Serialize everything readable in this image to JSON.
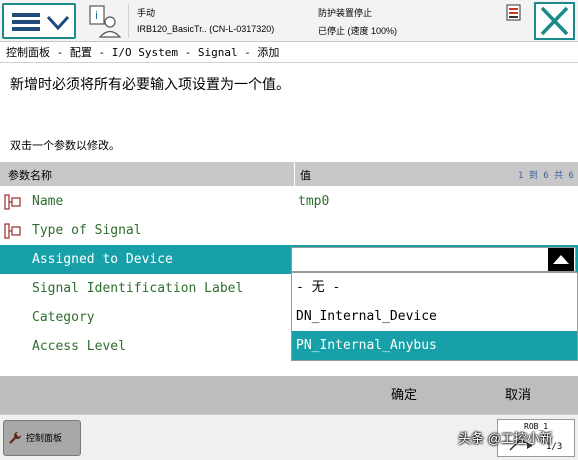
{
  "status": {
    "mode": "手动",
    "controller": "IRB120_BasicTr.. (CN-L-0317320)",
    "safety": "防护装置停止",
    "state": "已停止 (速度 100%)"
  },
  "breadcrumb": "控制面板 - 配置 - I/O System - Signal - 添加",
  "instruction": "新增时必须将所有必要输入项设置为一个值。",
  "hint": "双击一个参数以修改。",
  "table": {
    "col_name": "参数名称",
    "col_value": "值",
    "paging": "1 到 6 共 6",
    "rows": [
      {
        "label": "Name",
        "value": "tmp0",
        "required": true
      },
      {
        "label": "Type of Signal",
        "value": "",
        "required": true
      },
      {
        "label": "Assigned to Device",
        "value": "",
        "required": false
      },
      {
        "label": "Signal Identification Label",
        "value": "",
        "required": false
      },
      {
        "label": "Category",
        "value": "",
        "required": false
      },
      {
        "label": "Access Level",
        "value": "",
        "required": false
      }
    ]
  },
  "dropdown": {
    "current": "",
    "options": [
      "- 无 -",
      "DN_Internal_Device",
      "PN_Internal_Anybus"
    ],
    "highlighted": "PN_Internal_Anybus"
  },
  "actions": {
    "ok": "确定",
    "cancel": "取消"
  },
  "taskbar": {
    "control_panel": "控制面板",
    "rob": "ROB_1",
    "rob_num": "1/3"
  },
  "watermark": "头条 @工控小新",
  "colors": {
    "accent": "#17a0a8",
    "frame": "#1a8a8a",
    "label_green": "#2e6e2e"
  },
  "icons": [
    "menu-icon",
    "chevron-down-icon",
    "user-info-icon",
    "status-warning-icon",
    "close-icon",
    "required-field-icon",
    "triangle-up-icon",
    "wrench-icon",
    "robot-jog-icon"
  ]
}
